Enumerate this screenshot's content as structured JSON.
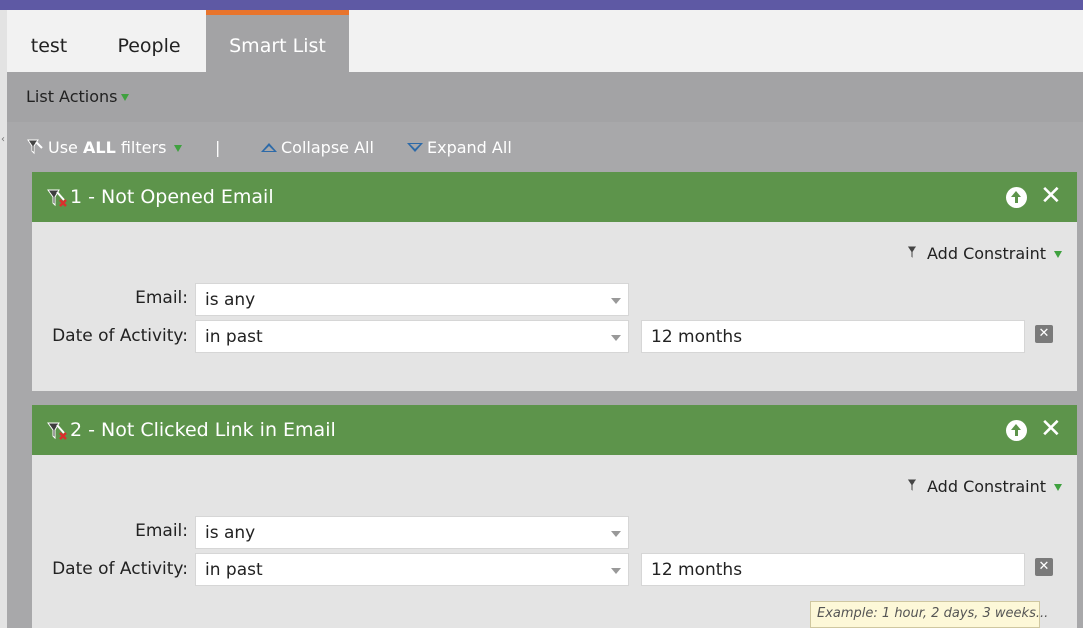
{
  "tabs": [
    {
      "label": "test"
    },
    {
      "label": "People"
    },
    {
      "label": "Smart List",
      "active": true
    }
  ],
  "list_actions": {
    "label": "List Actions"
  },
  "filter_bar": {
    "use_prefix": "Use ",
    "use_bold": "ALL",
    "use_suffix": " filters",
    "separator": "|",
    "collapse_label": "Collapse All",
    "expand_label": "Expand All"
  },
  "filters": [
    {
      "title": "1 - Not Opened Email",
      "add_constraint": "Add Constraint",
      "email_label": "Email:",
      "email_value": "is any",
      "date_label": "Date of Activity:",
      "date_operator": "in past",
      "date_value": "12 months"
    },
    {
      "title": "2 - Not Clicked Link in Email",
      "add_constraint": "Add Constraint",
      "email_label": "Email:",
      "email_value": "is any",
      "date_label": "Date of Activity:",
      "date_operator": "in past",
      "date_value": "12 months"
    }
  ],
  "tooltip": {
    "text": "Example: 1 hour, 2 days, 3 weeks..."
  },
  "colors": {
    "top_bar": "#5e59a4",
    "active_tab_accent": "#e8742c",
    "filter_header": "#5d944b",
    "menu_arrow": "#3fa13f",
    "collapse_expand_icon": "#2d6aa8"
  },
  "icons": {
    "filter": "funnel-icon",
    "filter_delete": "funnel-x-icon",
    "move_up": "arrow-up-circle-icon",
    "close": "close-icon",
    "remove_row": "remove-x-icon"
  }
}
